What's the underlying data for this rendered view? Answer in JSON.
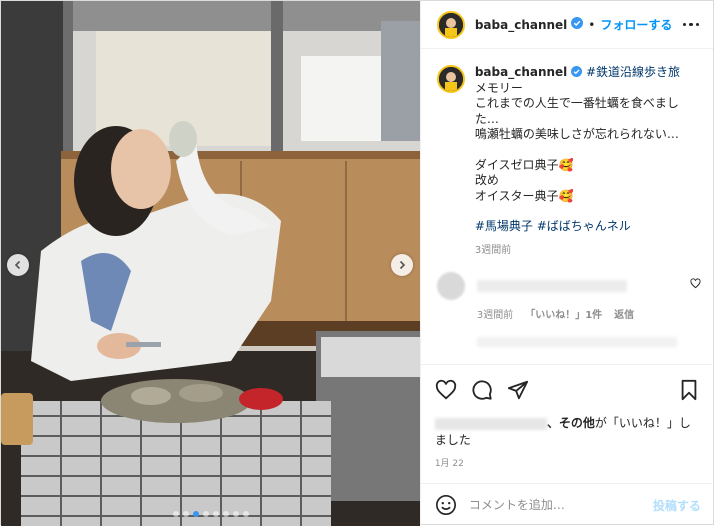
{
  "header": {
    "username": "baba_channel",
    "separator": "•",
    "follow_label": "フォローする"
  },
  "caption": {
    "username": "baba_channel",
    "hashtag_lead": "#鉄道沿線歩き旅",
    "lines": [
      "メモリー",
      "これまでの人生で一番牡蠣を食べまし",
      "た…",
      "鳴瀬牡蠣の美味しさが忘れられない…",
      "",
      "ダイスゼロ典子🥰",
      "改め",
      "オイスター典子🥰",
      "",
      "#馬場典子 #ばばちゃんネル"
    ],
    "time": "3週間前"
  },
  "comment": {
    "time": "3週間前",
    "likes_label": "「いいね！」1件",
    "reply_label": "返信"
  },
  "likes": {
    "text_tail": "、その他",
    "text_mid": "が「いいね！」し",
    "text_end": "ました"
  },
  "date": "1月 22",
  "add_comment": {
    "placeholder": "コメントを追加…",
    "post_label": "投稿する"
  },
  "carousel": {
    "slides": 8,
    "current": 2
  },
  "colors": {
    "accent": "#0095f6",
    "text": "#262626",
    "muted": "#8e8e8e"
  },
  "icons": {
    "verified": "verified-badge-icon",
    "more": "more-options-icon",
    "like": "heart-icon",
    "comment": "comment-icon",
    "share": "share-icon",
    "save": "bookmark-icon",
    "emoji": "emoji-icon"
  }
}
